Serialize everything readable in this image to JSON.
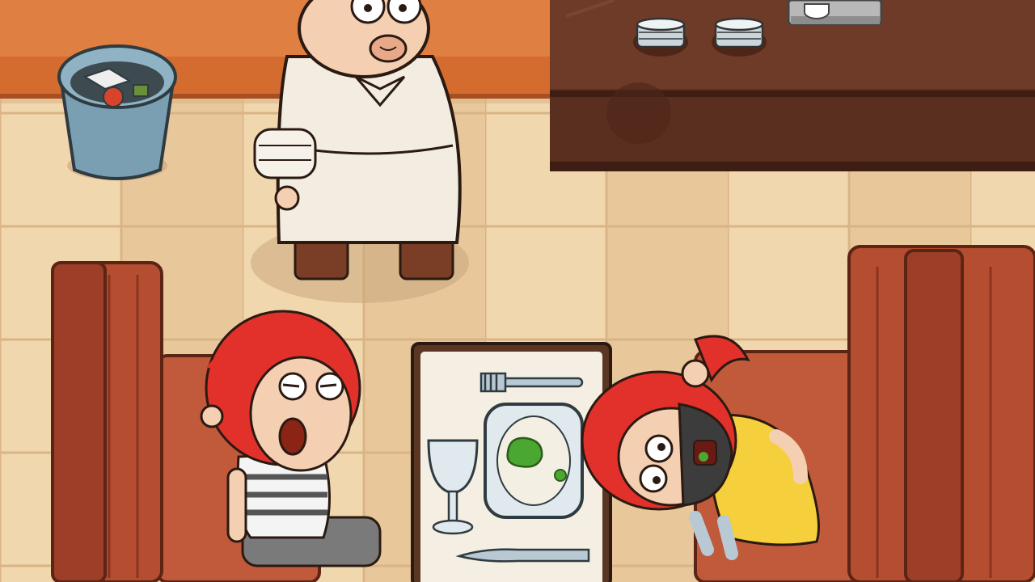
{
  "scene": {
    "kind": "point-and-click puzzle game, restaurant dining room",
    "colors": {
      "wall": "#e07f42",
      "floor_tile_a": "#f1d7ae",
      "floor_tile_b": "#e8c79a",
      "counter": "#6e3b28",
      "booth_red": "#c05a3a",
      "booth_dark": "#9d3f28",
      "hair_red": "#e2312a",
      "apron": "#f3ece0",
      "dress_yellow": "#f6cf3c"
    },
    "objects": {
      "trash_bin": {
        "icon": "trash-bin-icon"
      },
      "plates": {
        "icon": "stacked-plates-icon",
        "count": 2
      },
      "coffee_machine": {
        "icon": "coffee-machine-icon"
      },
      "chef": {
        "icon": "old-chef-character"
      },
      "boy": {
        "icon": "angry-boy-character"
      },
      "girl": {
        "icon": "choking-girl-character"
      },
      "table_items": [
        "fork-icon",
        "wine-glass-icon",
        "plate-with-green-food-icon",
        "knife-icon"
      ]
    }
  }
}
